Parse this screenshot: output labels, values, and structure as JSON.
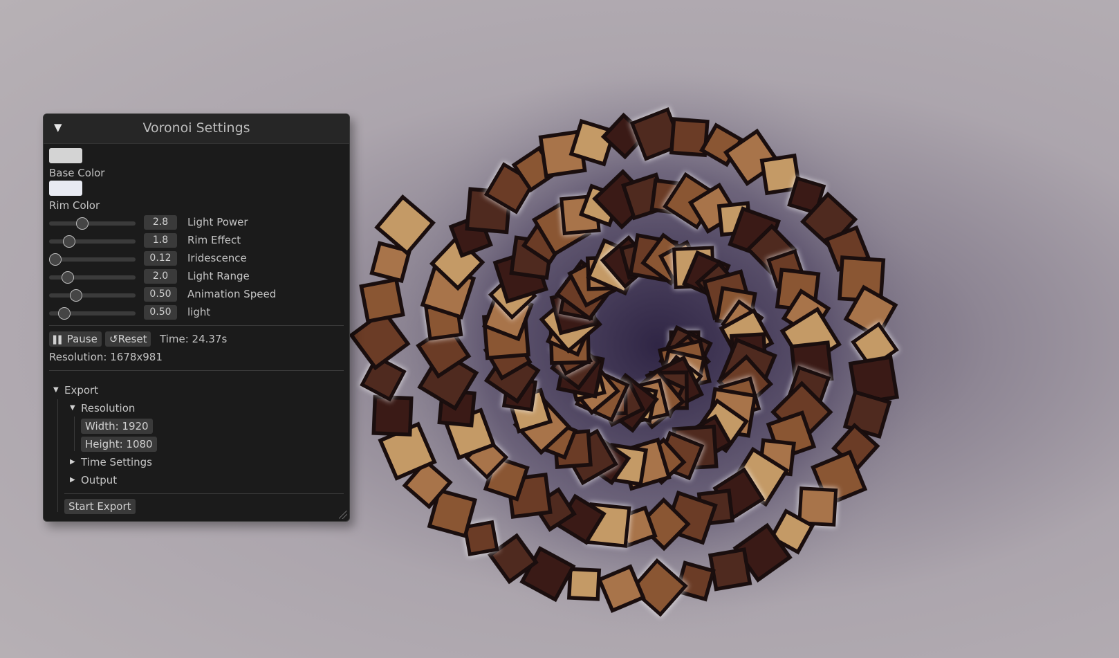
{
  "window": {
    "title": "Voronoi Settings",
    "collapse_glyph": "▼"
  },
  "colors": {
    "base_color_label": "Base Color",
    "base_color_value": "#d4d4d4",
    "rim_color_label": "Rim Color",
    "rim_color_value": "#e8eaf2"
  },
  "sliders": [
    {
      "label": "Light Power",
      "value": "2.8",
      "level": 0.36
    },
    {
      "label": "Rim Effect",
      "value": "1.8",
      "level": 0.19
    },
    {
      "label": "Iridescence",
      "value": "0.12",
      "level": 0.0
    },
    {
      "label": "Light Range",
      "value": "2.0",
      "level": 0.17
    },
    {
      "label": "Animation Speed",
      "value": "0.50",
      "level": 0.28
    },
    {
      "label": "light",
      "value": "0.50",
      "level": 0.12
    }
  ],
  "controls": {
    "pause_label": "Pause",
    "reset_label": "Reset",
    "time_text": "Time: 24.37s",
    "resolution_text": "Resolution: 1678x981"
  },
  "export": {
    "header": "Export",
    "resolution_header": "Resolution",
    "width_text": "Width: 1920",
    "height_text": "Height: 1080",
    "time_settings_header": "Time Settings",
    "output_header": "Output",
    "start_label": "Start Export"
  },
  "icons": {
    "pause": "pause-icon",
    "reset": "reset-icon",
    "collapse": "collapse-triangle-icon",
    "resize": "resize-grip-icon"
  }
}
